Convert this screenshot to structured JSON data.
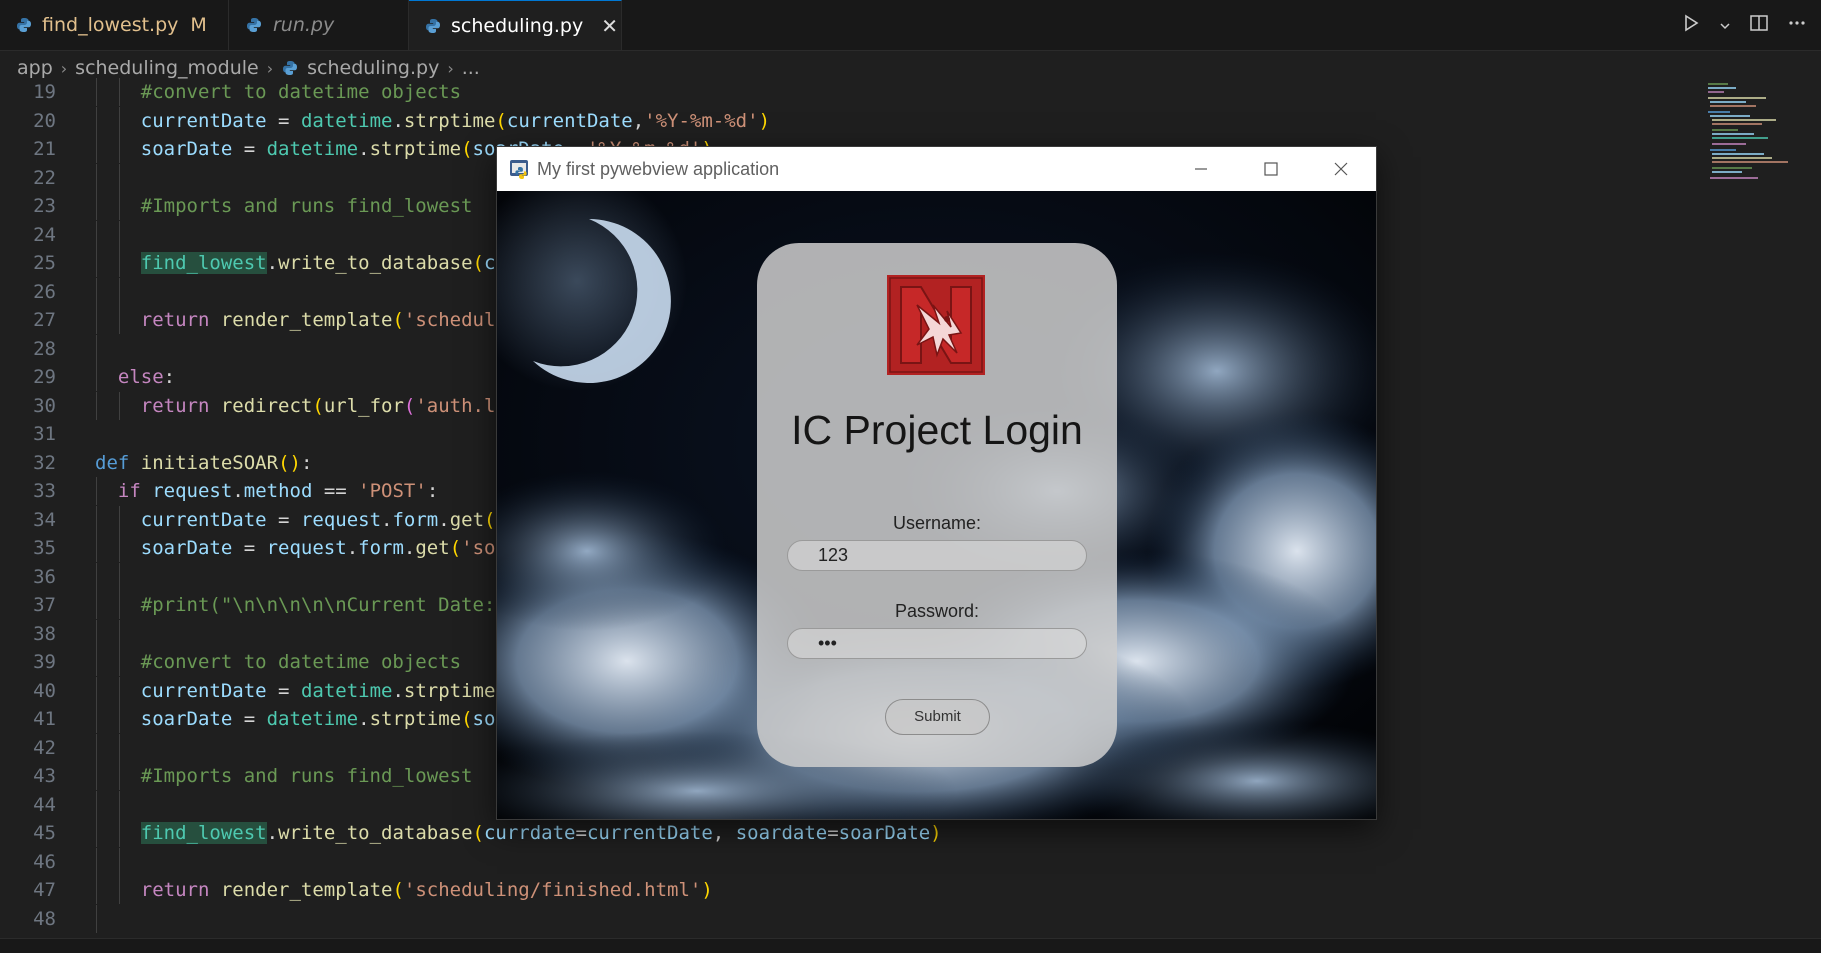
{
  "tabs": [
    {
      "label": "find_lowest.py",
      "modified": "M"
    },
    {
      "label": "run.py"
    },
    {
      "label": "scheduling.py",
      "close": "✕"
    }
  ],
  "breadcrumb": {
    "items": [
      "app",
      "scheduling_module",
      "scheduling.py",
      "..."
    ]
  },
  "editor": {
    "line_numbers": [
      "19",
      "20",
      "21",
      "22",
      "23",
      "24",
      "25",
      "26",
      "27",
      "28",
      "29",
      "30",
      "31",
      "32",
      "33",
      "34",
      "35",
      "36",
      "37",
      "38",
      "39",
      "40",
      "41",
      "42",
      "43",
      "44",
      "45",
      "46",
      "47",
      "48"
    ]
  },
  "pywebview": {
    "title": "My first pywebview application",
    "login": {
      "heading": "IC Project Login",
      "username_label": "Username:",
      "username_value": "123",
      "password_label": "Password:",
      "password_value": "•••",
      "submit_label": "Submit"
    }
  },
  "colors": {
    "accent": "#0078d4",
    "logo_red": "#b22222",
    "editor_bg": "#1f1f1f"
  }
}
